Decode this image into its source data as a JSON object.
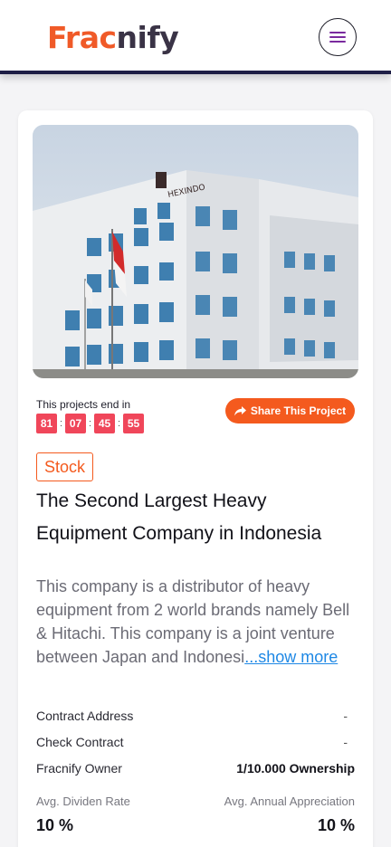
{
  "header": {
    "logo_part1": "Frac",
    "logo_part2": "nify",
    "menu_icon": "hamburger-menu-icon"
  },
  "project": {
    "image_alt": "Office building with Indonesian flag",
    "ends_label": "This projects end in",
    "countdown": [
      "81",
      "07",
      "45",
      "55"
    ],
    "share_label": "Share This Project",
    "share_icon": "share-icon",
    "category": "Stock",
    "title": "The Second Largest Heavy Equipment Company in Indonesia",
    "description": "This company is a distributor of heavy equipment from 2 world brands namely Bell & Hitachi. This company is a joint venture between Japan and Indonesi",
    "show_more": "...show more",
    "details": [
      {
        "label": "Contract Address",
        "value": "-"
      },
      {
        "label": "Check Contract",
        "value": "-"
      },
      {
        "label": "Fracnify Owner",
        "value": "1/10.000 Ownership"
      }
    ],
    "stats": {
      "dividen_label": "Avg. Dividen Rate",
      "appreciation_label": "Avg. Annual Appreciation",
      "dividen_value": "10 %",
      "appreciation_value": "10 %"
    }
  },
  "colors": {
    "brand_orange": "#f45a1e",
    "countdown_red": "#f0465a",
    "header_border": "#1f1f46",
    "link_blue": "#1e88e5"
  }
}
